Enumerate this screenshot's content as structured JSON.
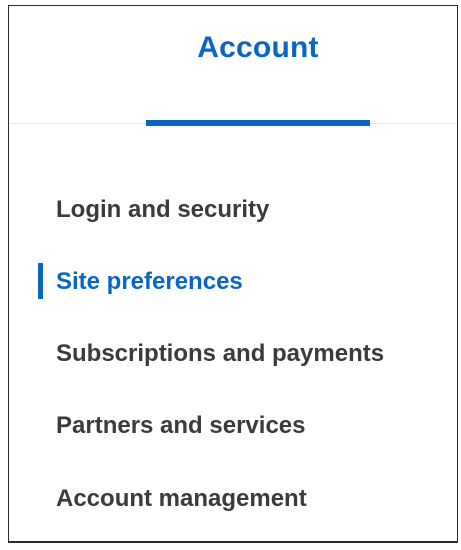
{
  "header": {
    "tab_label": "Account"
  },
  "nav": {
    "items": [
      {
        "label": "Login and security",
        "active": false
      },
      {
        "label": "Site preferences",
        "active": true
      },
      {
        "label": "Subscriptions and payments",
        "active": false
      },
      {
        "label": "Partners and services",
        "active": false
      },
      {
        "label": "Account management",
        "active": false
      }
    ]
  },
  "colors": {
    "accent": "#0a66c2",
    "text": "#3b3b3b",
    "divider": "#e5e5e5",
    "border": "#2b2b2b"
  }
}
